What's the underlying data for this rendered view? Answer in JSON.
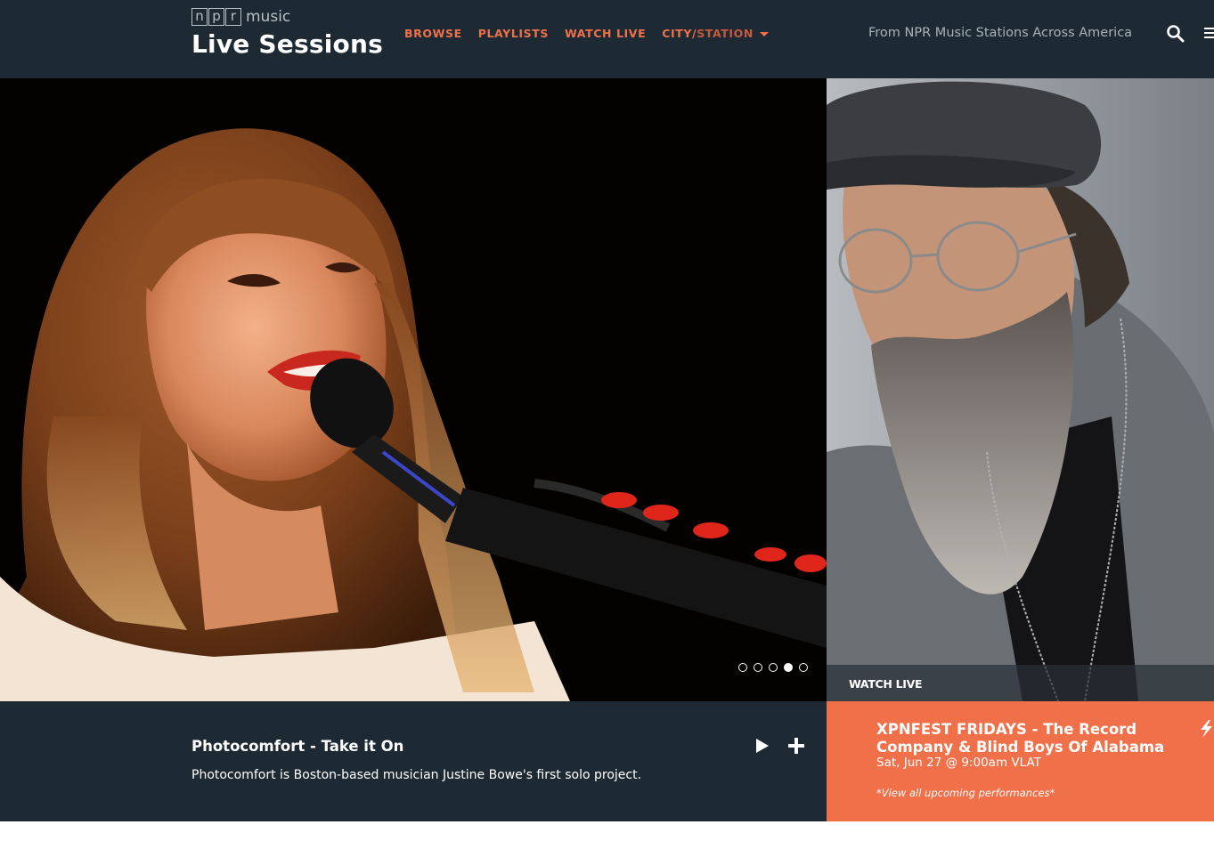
{
  "header": {
    "logo_letters": [
      "n",
      "p",
      "r"
    ],
    "logo_music": "music",
    "title": "Live Sessions",
    "tagline": "From NPR Music Stations Across America"
  },
  "nav": {
    "browse": "BROWSE",
    "playlists": "PLAYLISTS",
    "watch_live": "WATCH LIVE",
    "city": "CITY/",
    "station": "STATION"
  },
  "icons": {
    "search": "search-icon",
    "menu": "hamburger-menu-icon",
    "play": "play-icon",
    "add": "plus-icon",
    "bolt": "lightning-bolt-icon"
  },
  "carousel": {
    "slide_count": 5,
    "active_index": 3
  },
  "feature": {
    "title": "Photocomfort - Take it On",
    "description": "Photocomfort is Boston-based musician Justine Bowe's first solo project."
  },
  "side": {
    "label": "WATCH LIVE"
  },
  "event": {
    "title": "XPNFEST FRIDAYS - The Record Company & Blind Boys Of Alabama",
    "date": "Sat, Jun 27 @ 9:00am VLAT",
    "link": "*View all upcoming performances*"
  },
  "colors": {
    "header_bg": "#1d2a33",
    "accent": "#f0704a",
    "tagline": "#a9b1b6"
  }
}
